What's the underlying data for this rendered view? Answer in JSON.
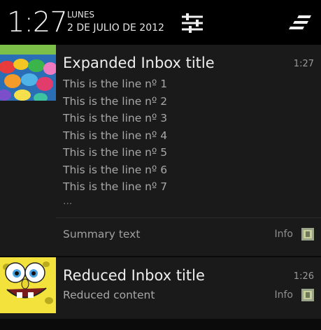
{
  "status": {
    "time": "1:27",
    "weekday": "LUNES",
    "date": "2 DE JULIO DE 2012",
    "icons": [
      "settings-sliders-icon",
      "clear-all-icon"
    ]
  },
  "notifications": [
    {
      "title": "Expanded Inbox title",
      "time": "1:27",
      "lines": [
        "This is the line nº 1",
        "This is the line nº 2",
        "This is the line nº 3",
        "This is the line nº 4",
        "This is the line nº 5",
        "This is the line nº 6",
        "This is the line nº 7"
      ],
      "more": "...",
      "summary": "Summary text",
      "info": "Info",
      "thumbnail": "jelly-beans-image",
      "small_icon": "app-small-icon"
    },
    {
      "title": "Reduced Inbox title",
      "time": "1:26",
      "content": "Reduced content",
      "info": "Info",
      "thumbnail": "sponge-character-image",
      "small_icon": "app-small-icon"
    }
  ],
  "colors": {
    "background": "#0b0b0b",
    "card": "#1a1a1a",
    "title": "#eeeeee",
    "secondary": "#a8a8a8"
  }
}
